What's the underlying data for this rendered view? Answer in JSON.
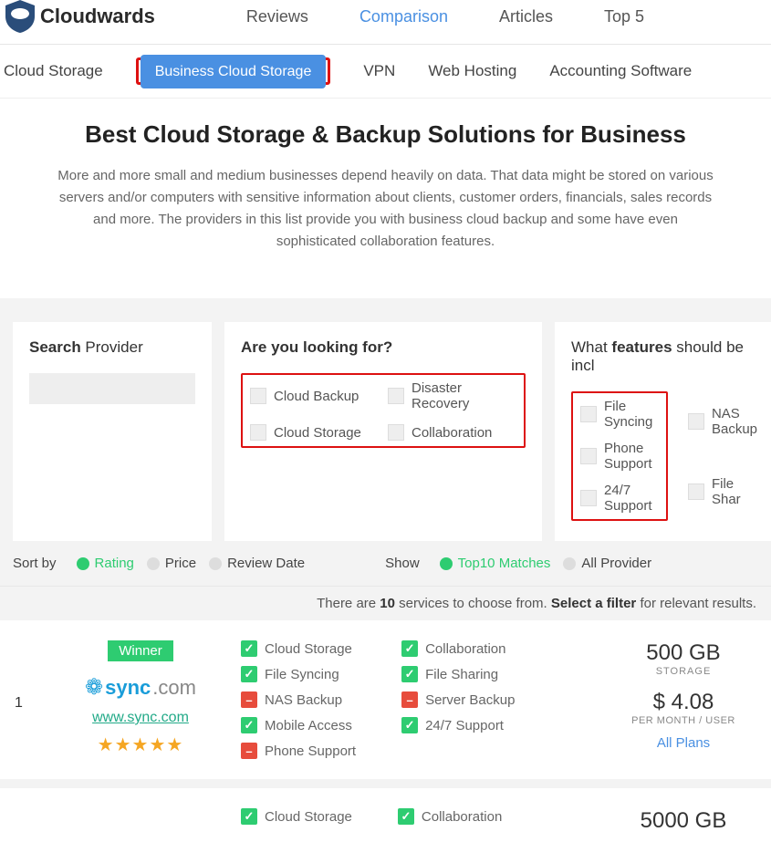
{
  "brand": "Cloudwards",
  "topnav": [
    "Reviews",
    "Comparison",
    "Articles",
    "Top 5"
  ],
  "topnav_active": 1,
  "subnav": [
    "Cloud Storage",
    "Business Cloud Storage",
    "VPN",
    "Web Hosting",
    "Accounting Software"
  ],
  "subnav_active": 1,
  "hero": {
    "title": "Best Cloud Storage & Backup Solutions for Business",
    "body": "More and more small and medium businesses depend heavily on data. That data might be stored on various servers and/or computers with sensitive information about clients, customer orders, financials, sales records and more. The providers in this list provide you with business cloud backup and some have even sophisticated collaboration features."
  },
  "search": {
    "label_strong": "Search",
    "label_rest": " Provider"
  },
  "looking": {
    "title": "Are you looking for?",
    "opts": [
      "Cloud Backup",
      "Disaster Recovery",
      "Cloud Storage",
      "Collaboration"
    ]
  },
  "features": {
    "title_a": "What ",
    "title_b": "features",
    "title_c": " should be incl",
    "col1": [
      "File Syncing",
      "Phone Support",
      "24/7 Support"
    ],
    "col2": [
      "NAS Backup",
      "File Shar"
    ]
  },
  "sort": {
    "label": "Sort by",
    "opts": [
      "Rating",
      "Price",
      "Review Date"
    ],
    "selected": 0,
    "show_label": "Show",
    "show_opts": [
      "Top10 Matches",
      "All Provider"
    ],
    "show_selected": 0
  },
  "resultbar": {
    "a": "There are ",
    "n": "10",
    "b": " services to choose from. ",
    "c": "Select a filter",
    "d": " for relevant results."
  },
  "cards": [
    {
      "rank": "1",
      "badge": "Winner",
      "logo_sync": "sync",
      "logo_dotcom": ".com",
      "link": "www.sync.com",
      "stars": "★★★★★",
      "features_l": [
        {
          "ok": true,
          "t": "Cloud Storage"
        },
        {
          "ok": true,
          "t": "File Syncing"
        },
        {
          "ok": false,
          "t": "NAS Backup"
        },
        {
          "ok": true,
          "t": "Mobile Access"
        },
        {
          "ok": false,
          "t": "Phone Support"
        }
      ],
      "features_r": [
        {
          "ok": true,
          "t": "Collaboration"
        },
        {
          "ok": true,
          "t": "File Sharing"
        },
        {
          "ok": false,
          "t": "Server Backup"
        },
        {
          "ok": true,
          "t": "24/7 Support"
        }
      ],
      "storage": "500 GB",
      "storage_label": "STORAGE",
      "price": "$ 4.08",
      "price_label": "PER MONTH / USER",
      "plans": "All Plans"
    },
    {
      "rank": "",
      "features_l": [
        {
          "ok": true,
          "t": "Cloud Storage"
        }
      ],
      "features_r": [
        {
          "ok": true,
          "t": "Collaboration"
        }
      ],
      "storage": "5000 GB"
    }
  ]
}
